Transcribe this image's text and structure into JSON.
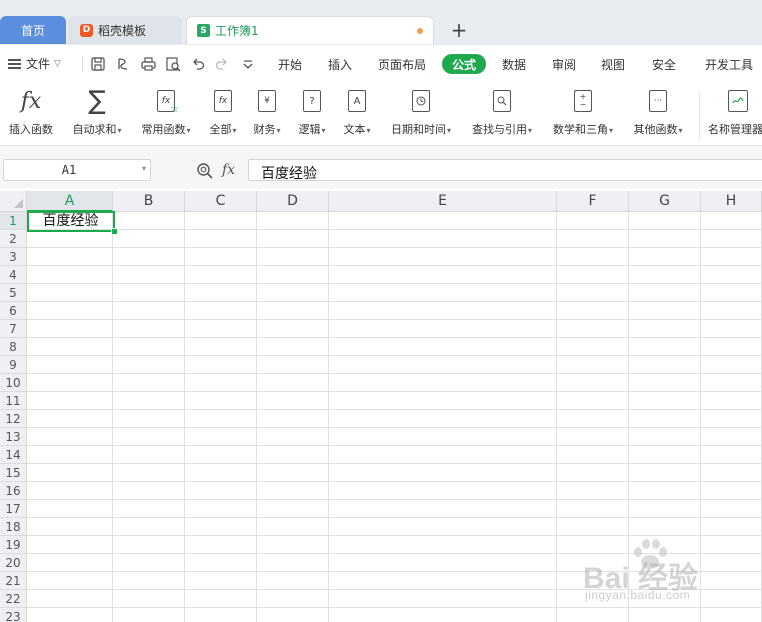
{
  "tabs": {
    "home": "首页",
    "docer": "稻壳模板",
    "workbook": "工作簿1",
    "add": "+"
  },
  "menu": {
    "file": "文件",
    "tabs": [
      "开始",
      "插入",
      "页面布局",
      "公式",
      "数据",
      "审阅",
      "视图",
      "安全",
      "开发工具"
    ],
    "active_tab": "公式"
  },
  "ribbon": {
    "buttons": [
      {
        "label": "插入函数",
        "dropdown": false,
        "icon": "fx-icon"
      },
      {
        "label": "自动求和",
        "dropdown": true,
        "icon": "sigma-icon"
      },
      {
        "label": "常用函数",
        "dropdown": true,
        "icon": "star-fx-icon"
      },
      {
        "label": "全部",
        "dropdown": true,
        "icon": "fx-book-icon"
      },
      {
        "label": "财务",
        "dropdown": true,
        "icon": "yen-book-icon"
      },
      {
        "label": "逻辑",
        "dropdown": true,
        "icon": "question-book-icon"
      },
      {
        "label": "文本",
        "dropdown": true,
        "icon": "text-book-icon"
      },
      {
        "label": "日期和时间",
        "dropdown": true,
        "icon": "clock-book-icon"
      },
      {
        "label": "查找与引用",
        "dropdown": true,
        "icon": "search-book-icon"
      },
      {
        "label": "数学和三角",
        "dropdown": true,
        "icon": "math-book-icon"
      },
      {
        "label": "其他函数",
        "dropdown": true,
        "icon": "dots-book-icon"
      },
      {
        "label": "名称管理器",
        "dropdown": false,
        "icon": "name-manager-icon"
      }
    ]
  },
  "formula_bar": {
    "name_box": "A1",
    "fx": "fx",
    "value": "百度经验"
  },
  "sheet": {
    "columns": [
      "A",
      "B",
      "C",
      "D",
      "E",
      "F",
      "G",
      "H"
    ],
    "rows": [
      "1",
      "2",
      "3",
      "4",
      "5",
      "6",
      "7",
      "8",
      "9",
      "10",
      "11",
      "12",
      "13",
      "14",
      "15",
      "16",
      "17",
      "18",
      "19",
      "20",
      "21",
      "22",
      "23"
    ],
    "active_cell": "A1",
    "cells": {
      "A1": "百度经验"
    }
  },
  "watermark": {
    "text": "Bai 经验",
    "url": "jingyan.baidu.com"
  },
  "colors": {
    "accent": "#1fa94f",
    "home_tab": "#5b8fde",
    "docer_icon": "#ef5a28"
  }
}
